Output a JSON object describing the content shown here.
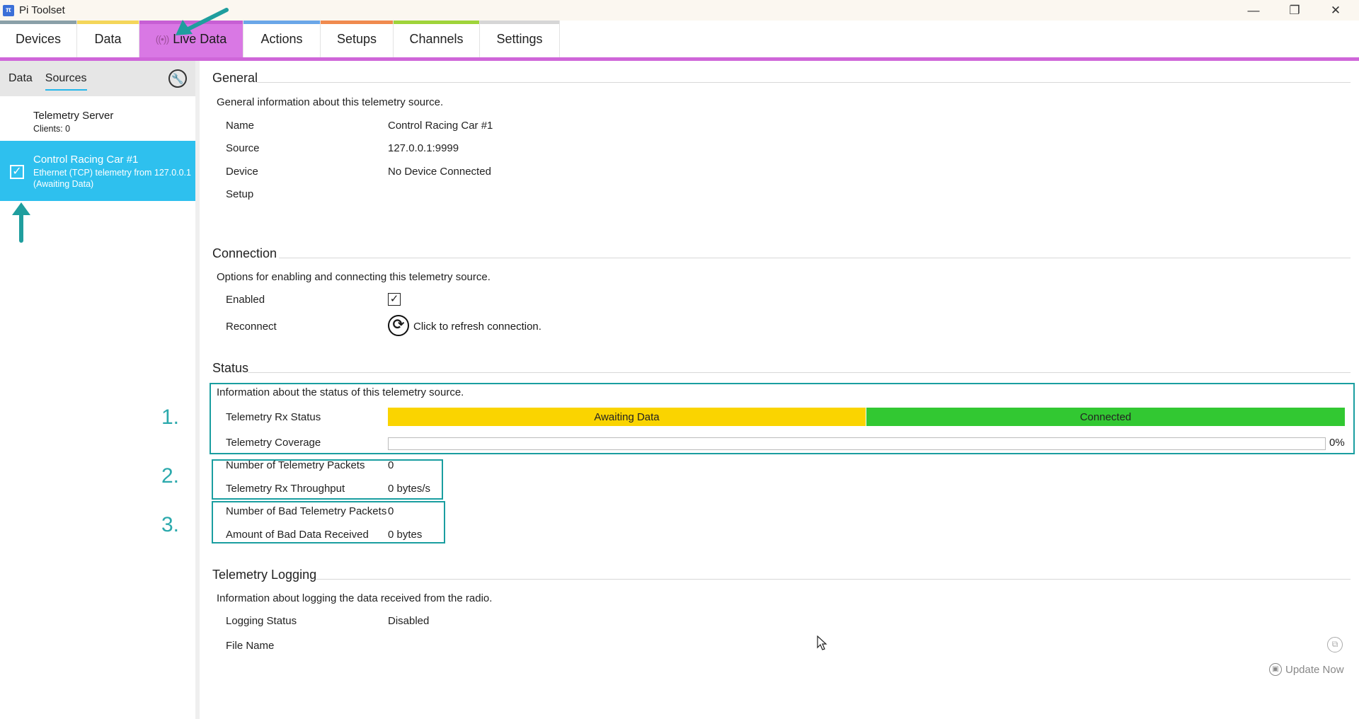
{
  "window": {
    "title": "Pi Toolset",
    "controls": {
      "minimize": "—",
      "restore": "❐",
      "close": "✕"
    }
  },
  "tabs": [
    {
      "label": "Devices",
      "stripe": "#8aa0a8"
    },
    {
      "label": "Data",
      "stripe": "#f4d65a"
    },
    {
      "label": "Live Data",
      "stripe": "#c75fd4",
      "icon": "broadcast-icon",
      "active": true
    },
    {
      "label": "Actions",
      "stripe": "#6aa6e8"
    },
    {
      "label": "Setups",
      "stripe": "#f08a4e"
    },
    {
      "label": "Channels",
      "stripe": "#9fd43a"
    },
    {
      "label": "Settings",
      "stripe": "#d6d6d6"
    }
  ],
  "sidebar": {
    "tabs": [
      "Data",
      "Sources"
    ],
    "active_tab": "Sources",
    "tool_icon": "wrench-icon",
    "items": [
      {
        "title": "Telemetry Server",
        "sub1": "Clients: 0",
        "sub2": ""
      },
      {
        "title": "Control Racing Car #1",
        "sub1": "Ethernet (TCP) telemetry from 127.0.0.1",
        "sub2": "(Awaiting Data)",
        "selected": true,
        "checked": "✓"
      }
    ]
  },
  "general": {
    "title": "General",
    "desc": "General information about this telemetry source.",
    "rows": [
      {
        "label": "Name",
        "value": "Control Racing Car #1"
      },
      {
        "label": "Source",
        "value": "127.0.0.1:9999"
      },
      {
        "label": "Device",
        "value": "No Device Connected"
      },
      {
        "label": "Setup",
        "value": ""
      }
    ]
  },
  "connection": {
    "title": "Connection",
    "desc": "Options for enabling and connecting this telemetry source.",
    "enabled_label": "Enabled",
    "enabled_check": "✓",
    "reconnect_label": "Reconnect",
    "reconnect_icon": "⟳",
    "reconnect_text": "Click to refresh connection."
  },
  "status": {
    "title": "Status",
    "desc": "Information about the status of this telemetry source.",
    "rx_status_label": "Telemetry Rx Status",
    "rx_states": [
      {
        "label": "Awaiting Data",
        "color": "#fad400"
      },
      {
        "label": "Connected",
        "color": "#32c832"
      }
    ],
    "coverage_label": "Telemetry Coverage",
    "coverage_percent": 0,
    "coverage_text": "0%",
    "packets_label": "Number of Telemetry Packets",
    "packets_value": "0",
    "throughput_label": "Telemetry Rx Throughput",
    "throughput_value": "0 bytes/s",
    "bad_packets_label": "Number of Bad Telemetry Packets",
    "bad_packets_value": "0",
    "bad_data_label": "Amount of Bad Data Received",
    "bad_data_value": "0 bytes"
  },
  "logging": {
    "title": "Telemetry Logging",
    "desc": "Information about logging the data received from the radio.",
    "status_label": "Logging Status",
    "status_value": "Disabled",
    "file_label": "File Name",
    "update_label": "Update Now"
  },
  "annotations": {
    "numbers": [
      "1.",
      "2.",
      "3."
    ],
    "color": "#1a9ea0"
  }
}
